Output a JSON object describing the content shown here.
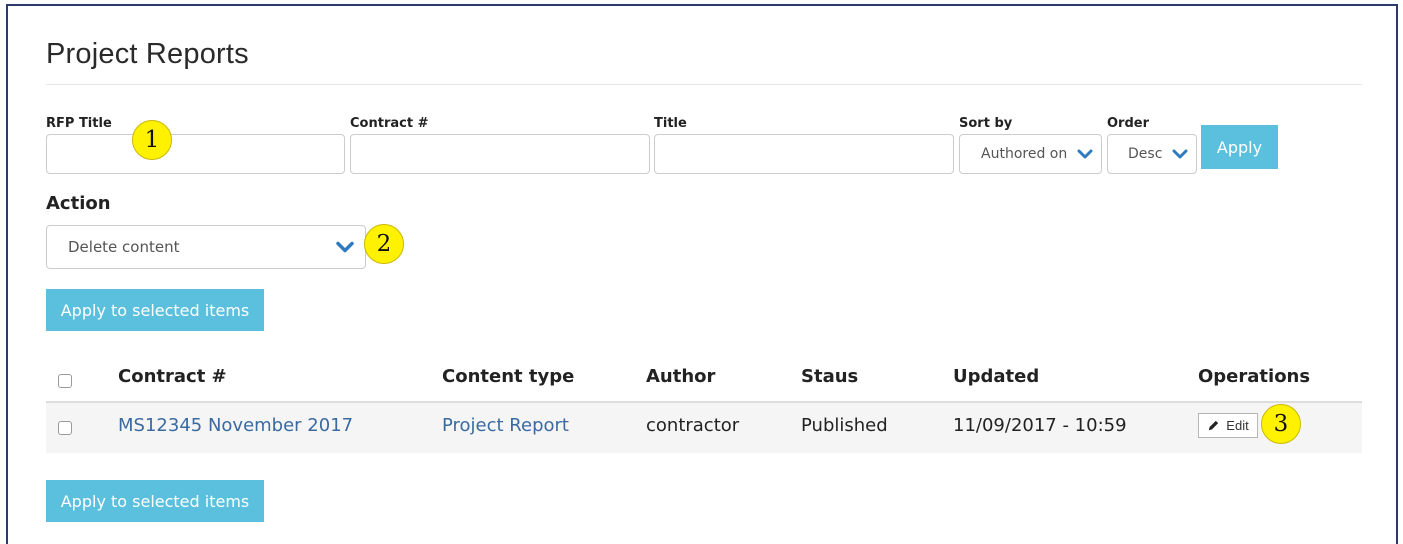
{
  "page": {
    "title": "Project Reports"
  },
  "filters": {
    "rfp_title": {
      "label": "RFP Title",
      "value": "",
      "placeholder": ""
    },
    "contract": {
      "label": "Contract #",
      "value": "",
      "placeholder": ""
    },
    "title": {
      "label": "Title",
      "value": "",
      "placeholder": ""
    },
    "sort_by": {
      "label": "Sort by",
      "selected": "Authored on"
    },
    "order": {
      "label": "Order",
      "selected": "Desc"
    },
    "apply_label": "Apply"
  },
  "bulk": {
    "action_label": "Action",
    "selected_action": "Delete content",
    "apply_label": "Apply to selected items"
  },
  "table": {
    "headers": {
      "contract": "Contract #",
      "content_type": "Content type",
      "author": "Author",
      "status": "Staus",
      "updated": "Updated",
      "operations": "Operations"
    },
    "rows": [
      {
        "contract": "MS12345 November 2017",
        "content_type": "Project Report",
        "author": "contractor",
        "status": "Published",
        "updated": "11/09/2017 - 10:59",
        "edit_label": "Edit"
      }
    ]
  },
  "markers": [
    "1",
    "2",
    "3"
  ],
  "colors": {
    "accent_button": "#5bc0de",
    "link": "#3a6aa0",
    "chevron": "#2f7bbf",
    "marker": "#fff200",
    "frame": "#2c3b6e"
  },
  "icons": {
    "chevron": "chevron-down-icon",
    "edit": "pencil-icon"
  }
}
